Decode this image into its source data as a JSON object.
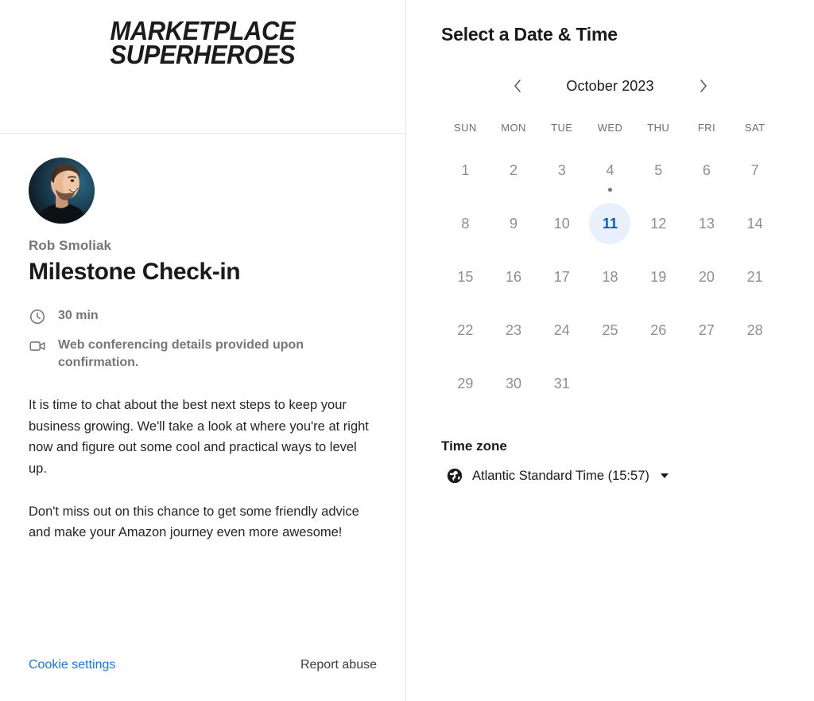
{
  "brand": {
    "logo_text": "MARKETPLACE\nSUPERHEROES",
    "logo_icon": "marketplace-superheroes-wordmark"
  },
  "event": {
    "host_name": "Rob Smoliak",
    "title": "Milestone Check-in",
    "duration": "30 min",
    "duration_icon": "clock-icon",
    "location": "Web conferencing details provided upon confirmation.",
    "location_icon": "video-camera-icon",
    "description": "It is time to chat about the best next steps to keep your business growing. We'll take a look at where you're at right now and figure out some cool and practical ways to level up.\n\nDon't miss out on this chance to get some friendly advice and make your Amazon journey even more awesome!"
  },
  "footer": {
    "cookie_settings": "Cookie settings",
    "report_abuse": "Report abuse",
    "link_color": "#1a73e8"
  },
  "picker": {
    "title": "Select a Date & Time",
    "month_label": "October 2023",
    "prev_icon": "chevron-left-icon",
    "next_icon": "chevron-right-icon",
    "weekday_headers": [
      "SUN",
      "MON",
      "TUE",
      "WED",
      "THU",
      "FRI",
      "SAT"
    ],
    "selected_day": 11,
    "today_day": 4,
    "selected_color": "#0b57d0",
    "selected_bg": "#e8f0fd",
    "days": [
      {
        "n": "1",
        "state": "disabled"
      },
      {
        "n": "2",
        "state": "disabled"
      },
      {
        "n": "3",
        "state": "disabled"
      },
      {
        "n": "4",
        "state": "today-disabled"
      },
      {
        "n": "5",
        "state": "disabled"
      },
      {
        "n": "6",
        "state": "disabled"
      },
      {
        "n": "7",
        "state": "disabled"
      },
      {
        "n": "8",
        "state": "disabled"
      },
      {
        "n": "9",
        "state": "disabled"
      },
      {
        "n": "10",
        "state": "disabled"
      },
      {
        "n": "11",
        "state": "selected"
      },
      {
        "n": "12",
        "state": "disabled"
      },
      {
        "n": "13",
        "state": "disabled"
      },
      {
        "n": "14",
        "state": "disabled"
      },
      {
        "n": "15",
        "state": "disabled"
      },
      {
        "n": "16",
        "state": "disabled"
      },
      {
        "n": "17",
        "state": "disabled"
      },
      {
        "n": "18",
        "state": "disabled"
      },
      {
        "n": "19",
        "state": "disabled"
      },
      {
        "n": "20",
        "state": "disabled"
      },
      {
        "n": "21",
        "state": "disabled"
      },
      {
        "n": "22",
        "state": "disabled"
      },
      {
        "n": "23",
        "state": "disabled"
      },
      {
        "n": "24",
        "state": "disabled"
      },
      {
        "n": "25",
        "state": "disabled"
      },
      {
        "n": "26",
        "state": "disabled"
      },
      {
        "n": "27",
        "state": "disabled"
      },
      {
        "n": "28",
        "state": "disabled"
      },
      {
        "n": "29",
        "state": "disabled"
      },
      {
        "n": "30",
        "state": "disabled"
      },
      {
        "n": "31",
        "state": "disabled"
      }
    ]
  },
  "timezone": {
    "label": "Time zone",
    "value": "Atlantic Standard Time (15:57)",
    "icon": "globe-icon"
  }
}
